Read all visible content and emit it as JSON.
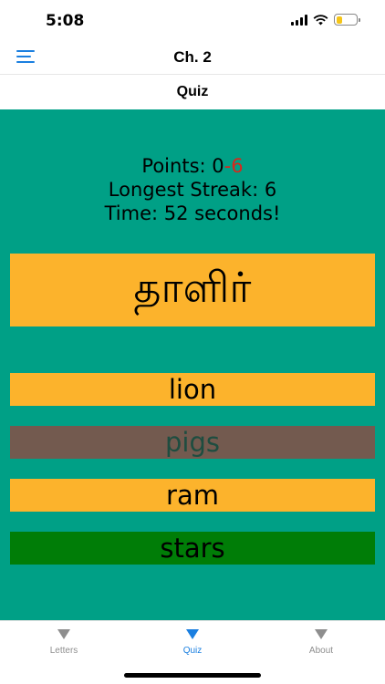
{
  "status_bar": {
    "time": "5:08",
    "battery_level": 0.3
  },
  "nav": {
    "title": "Ch. 2"
  },
  "subheader": {
    "title": "Quiz"
  },
  "stats": {
    "points_label": "Points: 0",
    "points_penalty": "-6",
    "streak": "Longest Streak: 6",
    "time": "Time: 52 seconds!"
  },
  "question": {
    "word": "தாளிர்"
  },
  "options": [
    {
      "label": "lion",
      "bg": "#fcb32c",
      "color": "#000000"
    },
    {
      "label": "pigs",
      "bg": "#735a4f",
      "color": "#1e4d40"
    },
    {
      "label": "ram",
      "bg": "#fcb32c",
      "color": "#000000"
    },
    {
      "label": "stars",
      "bg": "#007d07",
      "color": "#000000"
    }
  ],
  "tabs": [
    {
      "label": "Letters",
      "active": false
    },
    {
      "label": "Quiz",
      "active": true
    },
    {
      "label": "About",
      "active": false
    }
  ],
  "colors": {
    "accent": "#1a7fe0",
    "quiz_bg": "#00a086",
    "penalty": "#d8271c"
  }
}
